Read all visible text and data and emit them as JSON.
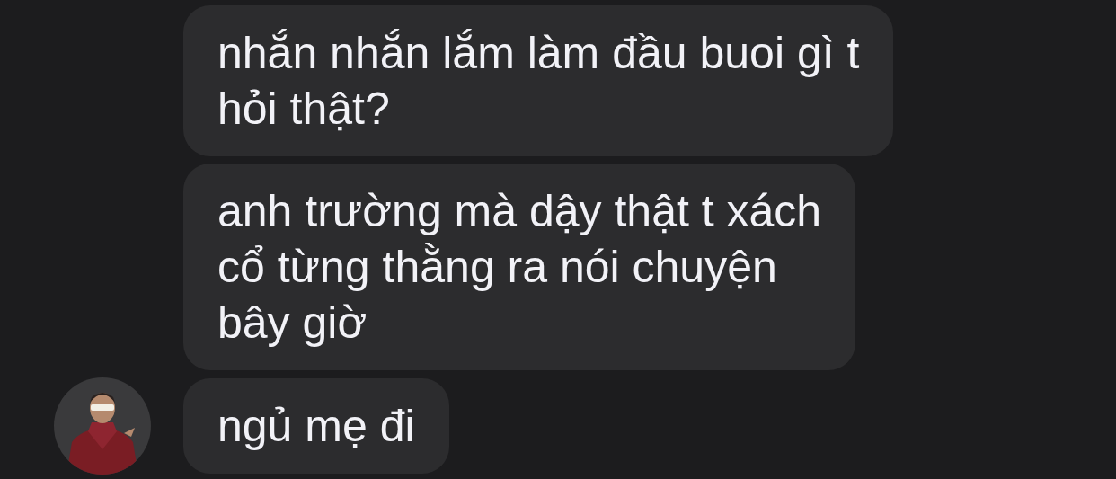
{
  "messages": [
    {
      "lines": [
        "nhắn nhắn lắm làm đầu buoi gì t",
        "hỏi thật?"
      ],
      "avatar": false
    },
    {
      "lines": [
        "anh trường mà dậy thật t xách",
        "cổ từng thằng ra nói chuyện",
        "bây giờ"
      ],
      "avatar": false
    },
    {
      "lines": [
        "ngủ mẹ đi"
      ],
      "avatar": true
    }
  ]
}
